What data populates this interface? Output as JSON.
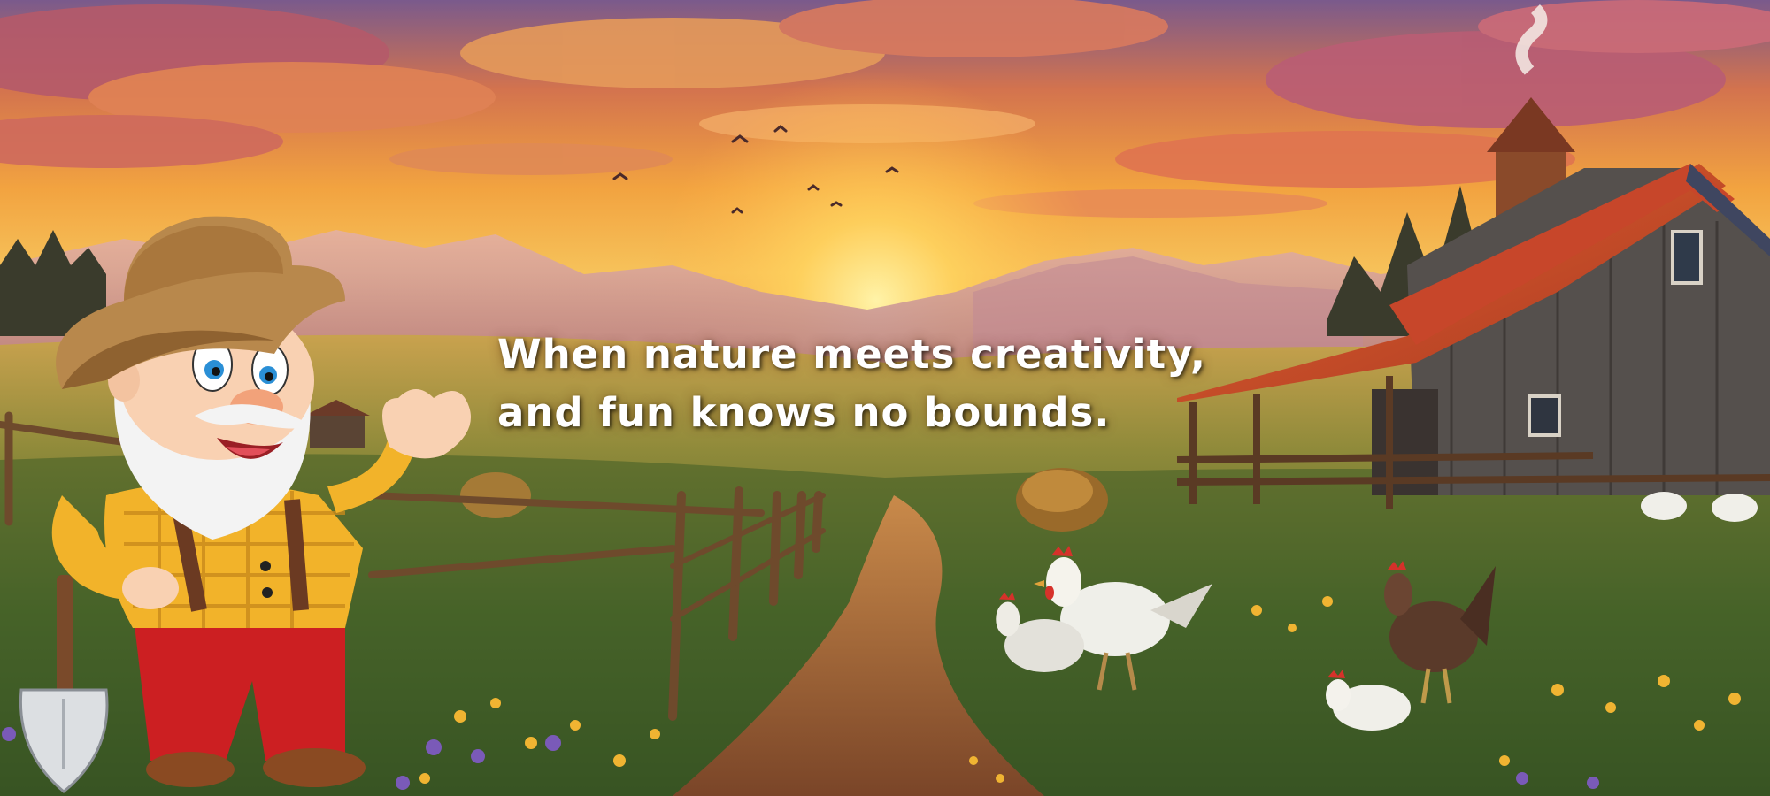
{
  "banner": {
    "tagline": {
      "line1": "When nature meets creativity,",
      "line2": "and fun knows no bounds."
    },
    "colors": {
      "sky_top": "#6f5a8a",
      "sky_glow": "#ffd15a",
      "sunset_orange": "#f08a3a",
      "mountains": "#b7859a",
      "field_green": "#4d6a2c",
      "path_dirt": "#8a5530",
      "barn_roof": "#c9482a",
      "barn_wall": "#55504d",
      "text": "#ffffff"
    },
    "icons": [
      "farmer-mascot",
      "shovel-icon",
      "barn",
      "silo",
      "chicken",
      "hay-bale",
      "wooden-fence",
      "wildflowers",
      "birds"
    ]
  }
}
